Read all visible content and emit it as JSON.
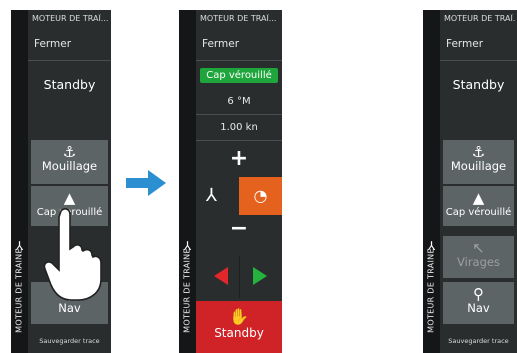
{
  "panel_left": {
    "header": "MOTEUR DE TRAÎ...",
    "close": "Fermer",
    "mode": "Standby",
    "buttons": [
      {
        "label": "Mouillage",
        "icon": "⚓"
      },
      {
        "label": "Cap verouillé",
        "icon": "▲"
      },
      {
        "label": "Nav",
        "icon": "⚲"
      }
    ],
    "save": "Sauvegarder trace",
    "side_label": "MOTEUR DE TRAINE"
  },
  "panel_middle": {
    "header": "MOTEUR DE TRAÎ...",
    "close": "Fermer",
    "status": "Cap vérouillé",
    "heading": "6 °M",
    "speed": "1.00 kn",
    "plus": "+",
    "minus": "−",
    "standby": "Standby",
    "side_label": "MOTEUR DE TRAINE"
  },
  "panel_right": {
    "header": "MOTEUR DE TRAÎ...",
    "close": "Fermer",
    "mode": "Standby",
    "buttons": [
      {
        "label": "Mouillage",
        "icon": "⚓"
      },
      {
        "label": "Cap vérouillé",
        "icon": "▲"
      },
      {
        "label": "Virages",
        "icon": "↖"
      },
      {
        "label": "Nav",
        "icon": "⚲"
      }
    ],
    "save": "Sauvegarder trace",
    "side_label": "MOTEUR DE TRAINE"
  },
  "colors": {
    "accent_green": "#1ea53b",
    "accent_orange": "#e4621e",
    "accent_red": "#cf2328",
    "arrow_blue": "#2b8fd1"
  }
}
